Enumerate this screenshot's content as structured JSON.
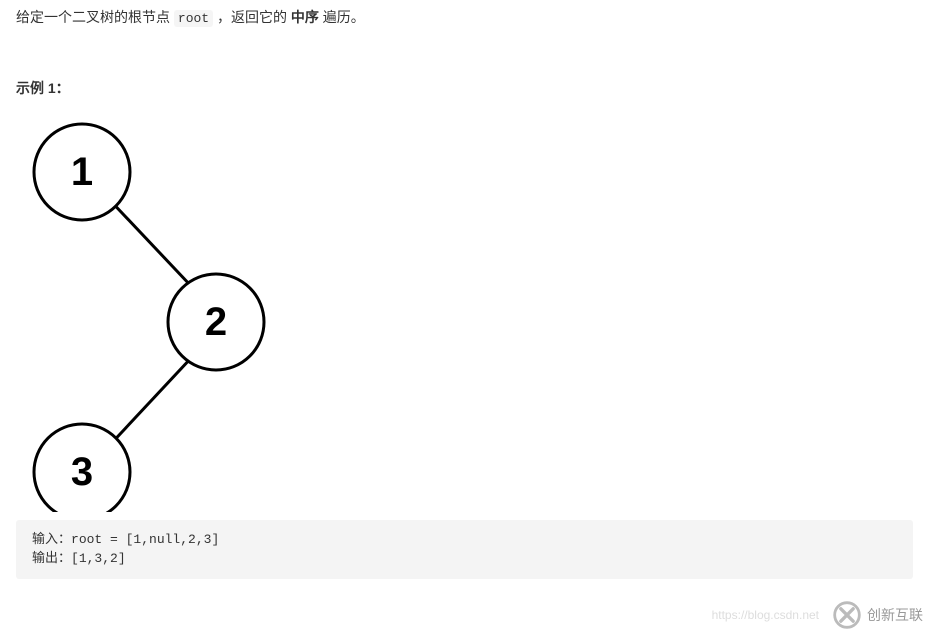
{
  "intro": {
    "part1": "给定一个二叉树的根节点 ",
    "code": "root",
    "part2": " ，返回它的 ",
    "bold": "中序",
    "part3": " 遍历。"
  },
  "example": {
    "label": "示例 1："
  },
  "tree": {
    "nodes": [
      "1",
      "2",
      "3"
    ]
  },
  "code": {
    "input_label": "输入：",
    "input_value": "root = [1,null,2,3]",
    "output_label": "输出：",
    "output_value": "[1,3,2]"
  },
  "watermark": {
    "url": "https://blog.csdn.net",
    "brand": "创新互联"
  }
}
